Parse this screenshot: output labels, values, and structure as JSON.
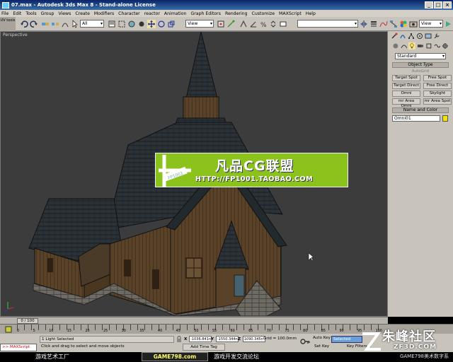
{
  "window": {
    "title": "07.max - Autodesk 3ds Max 8 - Stand-alone License"
  },
  "menu": [
    "File",
    "Edit",
    "Tools",
    "Group",
    "Views",
    "Create",
    "Modifiers",
    "Character",
    "reactor",
    "Animation",
    "Graph Editors",
    "Rendering",
    "Customize",
    "MAXScript",
    "Help"
  ],
  "toolbar": {
    "selection_filter": "All",
    "ref_coord": "View",
    "named_selection": "",
    "view_dropdown": "View"
  },
  "leftstrip": {
    "label": "UV tools"
  },
  "viewport": {
    "label": "Perspective"
  },
  "cmdpanel": {
    "dropdown": "Standard",
    "object_type_header": "Object Type",
    "autogrid": "AutoGrid",
    "buttons": [
      "Target Spot",
      "Free Spot",
      "Target Direct",
      "Free Direct",
      "Omni",
      "Skylight",
      "mr Area Omni",
      "mr Area Spot"
    ],
    "name_color_header": "Name and Color",
    "name_value": "Omni01",
    "swatch_color": "#f5e400"
  },
  "timeline": {
    "slider": "0 / 100",
    "ticks": [
      "0",
      "5",
      "10",
      "15",
      "20",
      "25",
      "30",
      "35",
      "40",
      "45",
      "50",
      "55",
      "60",
      "65",
      "70",
      "75",
      "80",
      "85",
      "90",
      "95",
      "100"
    ]
  },
  "status": {
    "maxscript": ">> MAXScript",
    "light_selected": "1 Light Selected",
    "hint": "Click and drag to select and move objects",
    "x_label": "X",
    "x_value": "-1036.841n",
    "y_label": "Y",
    "y_value": "-1550.344n",
    "z_label": "Z",
    "z_value": "1090.345n",
    "grid": "Grid = 100.0mm",
    "add_time_tag": "Add Time Tag",
    "auto_key": "Auto Key",
    "selected": "Selected",
    "set_key": "Set Key",
    "key_filters": "Key Filters..."
  },
  "watermarks": {
    "bottom_left": "游戏艺术工厂",
    "bottom_center": "GAME798.com",
    "bottom_center2": "游戏开发交流论坛",
    "bottom_right": "GAME798美术数字系",
    "zf_title": "朱峰社区",
    "zf_sub": "ZF3D.COM",
    "banner_title": "凡品CG联盟",
    "banner_url": "HTTP://FP1001.TAOBAO.COM",
    "banner_badge": "FP1001"
  }
}
